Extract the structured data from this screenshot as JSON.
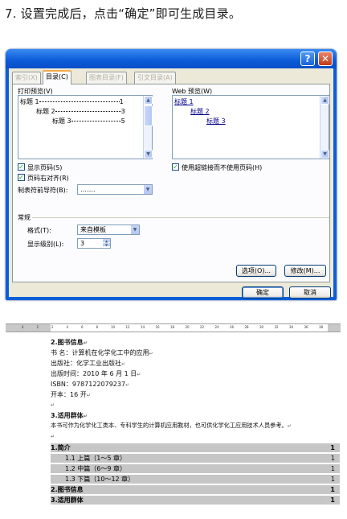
{
  "step_title": "7. 设置完成后，点击“确定”即可生成目录。",
  "dialog": {
    "help_icon": "?",
    "close_icon": "✕",
    "tabs": [
      "索引(X)",
      "目录(C)",
      "图表目录(F)",
      "引文目录(A)"
    ],
    "print_preview": {
      "label": "打印预览(V)",
      "lines": [
        {
          "text": "标题 1",
          "page": "1"
        },
        {
          "text": "标题 2",
          "page": "3"
        },
        {
          "text": "标题 3",
          "page": "5"
        }
      ]
    },
    "web_preview": {
      "label": "Web 预览(W)",
      "lines": [
        "标题 1",
        "标题 2",
        "标题 3"
      ]
    },
    "options": {
      "show_page_numbers": "显示页码(S)",
      "right_align_page_numbers": "页码右对齐(R)",
      "use_hyperlinks": "使用超链接而不使用页码(H)",
      "tab_leader_label": "制表符前导符(B):",
      "tab_leader_value": "……."
    },
    "general": {
      "title": "常规",
      "format_label": "格式(T):",
      "format_value": "来自模板",
      "levels_label": "显示级别(L):",
      "levels_value": "3"
    },
    "buttons": {
      "options": "选项(O)...",
      "modify": "修改(M)...",
      "ok": "确定",
      "cancel": "取消"
    }
  },
  "document": {
    "ruler_ticks": [
      "4",
      "2",
      "2",
      "4",
      "6",
      "8",
      "10",
      "12",
      "14",
      "16",
      "18",
      "20",
      "22",
      "24",
      "26",
      "28",
      "30",
      "32",
      "34",
      "36",
      "38"
    ],
    "lines": {
      "book_info_heading": "2.图书信息",
      "book_title": "书  名：计算机在化学化工中的应用",
      "publisher": "出版社：化学工业出版社",
      "pub_date": "出版时间：2010 年 6 月 1 日",
      "isbn": "ISBN：9787122079237",
      "format": "开本：16 开",
      "audience_heading": "3.适用群体",
      "audience_text": "本书可作为化学化工类本、专科学生的计算机应用教材，也可供化学化工应用技术人员参考。"
    },
    "toc": [
      {
        "text": "1.简介",
        "page": "1",
        "indent": 0,
        "bold": true
      },
      {
        "text": "1.1 上篇（1～5 章）",
        "page": "1",
        "indent": 1,
        "bold": false
      },
      {
        "text": "1.2 中篇（6～9 章）",
        "page": "1",
        "indent": 1,
        "bold": false
      },
      {
        "text": "1.3 下篇（10～12 章）",
        "page": "1",
        "indent": 1,
        "bold": false
      },
      {
        "text": "2.图书信息",
        "page": "1",
        "indent": 0,
        "bold": true
      },
      {
        "text": "3.适用群体",
        "page": "1",
        "indent": 0,
        "bold": true
      }
    ]
  }
}
